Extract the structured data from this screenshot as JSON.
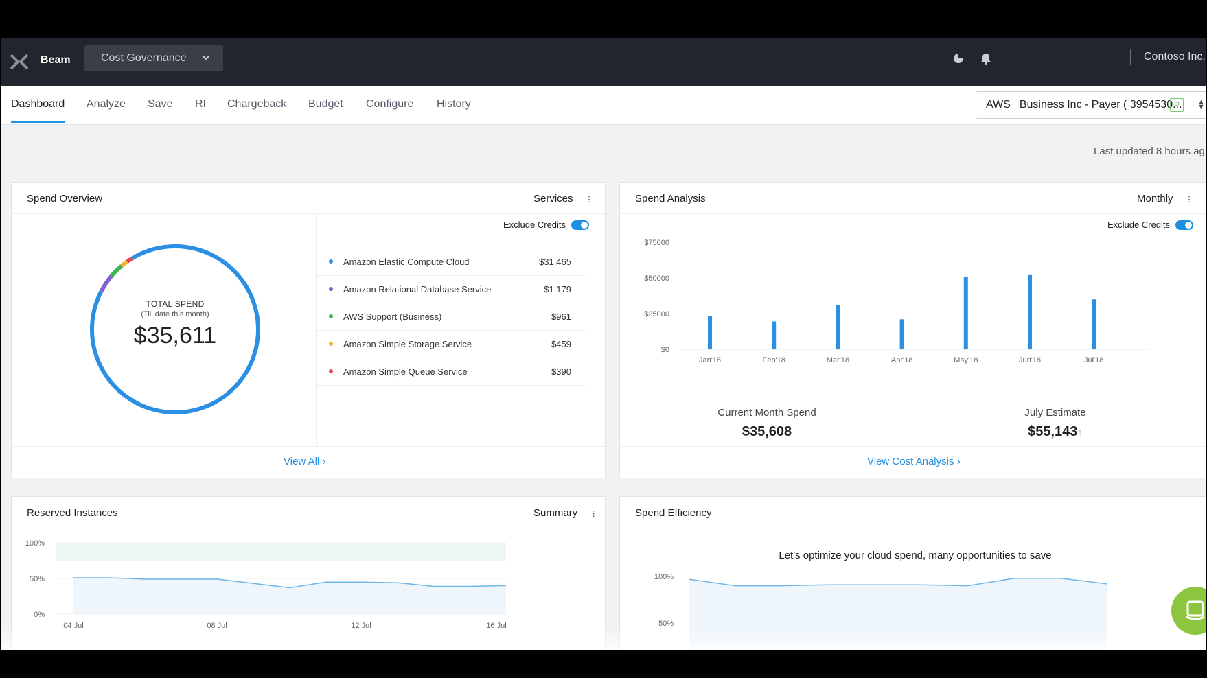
{
  "topbar": {
    "brand": "Beam",
    "app_selector": "Cost Governance",
    "org": "Contoso Inc."
  },
  "nav": {
    "tabs": [
      "Dashboard",
      "Analyze",
      "Save",
      "RI",
      "Chargeback",
      "Budget",
      "Configure",
      "History"
    ],
    "active_tab": "Dashboard",
    "account": {
      "cloud": "AWS",
      "name": "Business Inc - Payer ( 3954530...",
      "badge": "P"
    }
  },
  "last_updated": "Last updated 8 hours ag",
  "spend_overview": {
    "title": "Spend Overview",
    "control": "Services",
    "exclude_credits_label": "Exclude Credits",
    "total_label": "TOTAL SPEND",
    "total_sub": "(Till date this month)",
    "total_value": "$35,611",
    "services": [
      {
        "name": "Amazon Elastic Compute Cloud",
        "value": "$31,465",
        "amount": 31465,
        "color": "#2b8fe3"
      },
      {
        "name": "Amazon Relational Database Service",
        "value": "$1,179",
        "amount": 1179,
        "color": "#8160d0"
      },
      {
        "name": "AWS Support (Business)",
        "value": "$961",
        "amount": 961,
        "color": "#3cb553"
      },
      {
        "name": "Amazon Simple Storage Service",
        "value": "$459",
        "amount": 459,
        "color": "#f2b630"
      },
      {
        "name": "Amazon Simple Queue Service",
        "value": "$390",
        "amount": 390,
        "color": "#e8465a"
      }
    ],
    "view_all": "View All"
  },
  "spend_analysis": {
    "title": "Spend Analysis",
    "control": "Monthly",
    "exclude_credits_label": "Exclude Credits",
    "current_month_label": "Current Month Spend",
    "current_month_value": "$35,608",
    "estimate_label": "July Estimate",
    "estimate_value": "$55,143",
    "view_link": "View Cost Analysis"
  },
  "chart_data": [
    {
      "type": "bar",
      "categories": [
        "Jan'18",
        "Feb'18",
        "Mar'18",
        "Apr'18",
        "May'18",
        "Jun'18",
        "Jul'18"
      ],
      "values": [
        23500,
        19500,
        31000,
        21000,
        51000,
        52000,
        35000
      ],
      "ytick_labels": [
        "$0",
        "$25000",
        "$50000",
        "$75000"
      ],
      "yticks": [
        0,
        25000,
        50000,
        75000
      ],
      "ylim": [
        0,
        75000
      ],
      "color": "#2b8fe3"
    },
    {
      "type": "area",
      "x": [
        "04 Jul",
        "05 Jul",
        "06 Jul",
        "07 Jul",
        "08 Jul",
        "09 Jul",
        "10 Jul",
        "11 Jul",
        "12 Jul",
        "13 Jul",
        "14 Jul",
        "15 Jul",
        "16 Jul"
      ],
      "xtick_labels": [
        "04 Jul",
        "08 Jul",
        "12 Jul",
        "16 Jul"
      ],
      "values": [
        51,
        51,
        49,
        49,
        49,
        43,
        37,
        45,
        45,
        44,
        39,
        39,
        40
      ],
      "ytick_labels": [
        "0%",
        "50%",
        "100%"
      ],
      "ylim": [
        0,
        100
      ],
      "color": "#6cb6e8"
    },
    {
      "type": "area",
      "values": [
        97,
        90,
        90,
        91,
        91,
        91,
        90,
        98,
        98,
        92
      ],
      "ytick_labels": [
        "50%",
        "100%"
      ],
      "ylim": [
        0,
        100
      ],
      "color": "#6cb6e8"
    }
  ],
  "reserved_instances": {
    "title": "Reserved Instances",
    "control": "Summary"
  },
  "spend_efficiency": {
    "title": "Spend Efficiency",
    "message": "Let's optimize your cloud spend, many opportunities to save"
  }
}
